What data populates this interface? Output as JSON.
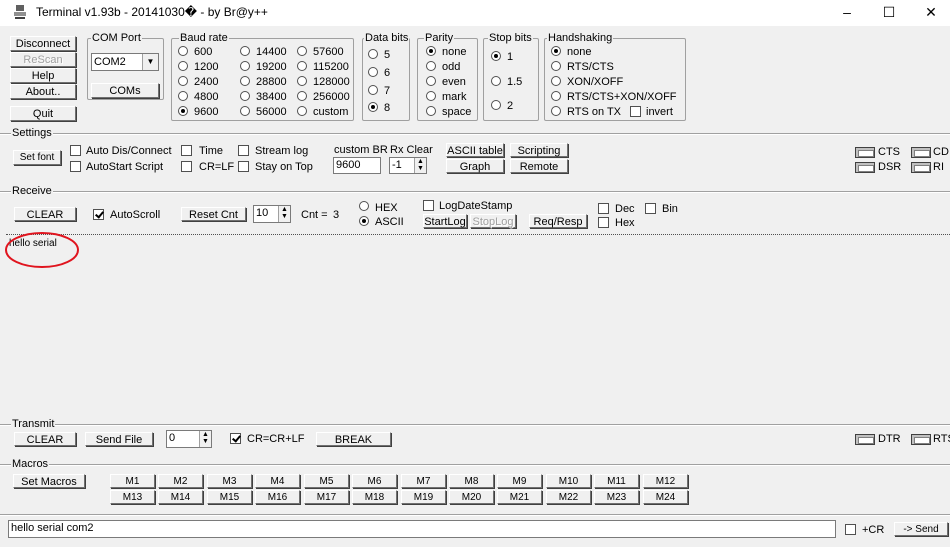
{
  "window": {
    "title": "Terminal v1.93b - 20141030� - by Br@y++",
    "icon_name": "terminal-app-icon",
    "minimize_glyph": "–",
    "maximize_glyph": "☐",
    "close_glyph": "✕"
  },
  "top_buttons": {
    "disconnect": "Disconnect",
    "rescan": "ReScan",
    "help": "Help",
    "about": "About..",
    "quit": "Quit"
  },
  "com_port": {
    "label": "COM Port",
    "selected": "COM2",
    "coms_button": "COMs"
  },
  "baud_rate": {
    "label": "Baud rate",
    "options": [
      "600",
      "1200",
      "2400",
      "4800",
      "9600",
      "14400",
      "19200",
      "28800",
      "38400",
      "56000",
      "57600",
      "115200",
      "128000",
      "256000",
      "custom"
    ],
    "selected": "9600"
  },
  "data_bits": {
    "label": "Data bits",
    "options": [
      "5",
      "6",
      "7",
      "8"
    ],
    "selected": "8"
  },
  "parity": {
    "label": "Parity",
    "options": [
      "none",
      "odd",
      "even",
      "mark",
      "space"
    ],
    "selected": "none"
  },
  "stop_bits": {
    "label": "Stop bits",
    "options": [
      "1",
      "1.5",
      "2"
    ],
    "selected": "1"
  },
  "handshaking": {
    "label": "Handshaking",
    "options": [
      "none",
      "RTS/CTS",
      "XON/XOFF",
      "RTS/CTS+XON/XOFF",
      "RTS on TX"
    ],
    "selected": "none",
    "invert_label": "invert"
  },
  "settings": {
    "label": "Settings",
    "set_font": "Set font",
    "auto_dis_connect": "Auto Dis/Connect",
    "autostart_script": "AutoStart Script",
    "time": "Time",
    "cr_lf": "CR=LF",
    "stream_log": "Stream log",
    "stay_on_top": "Stay on Top",
    "custom_br_label": "custom BR",
    "custom_br_value": "9600",
    "rx_clear_label": "Rx Clear",
    "rx_clear_value": "-1",
    "ascii_table": "ASCII table",
    "graph": "Graph",
    "scripting": "Scripting",
    "remote": "Remote",
    "leds": [
      "CTS",
      "CD",
      "DSR",
      "RI"
    ]
  },
  "receive": {
    "label": "Receive",
    "clear": "CLEAR",
    "autoscroll": "AutoScroll",
    "reset_cnt": "Reset Cnt",
    "cnt_spin_value": "10",
    "cnt_label": "Cnt =",
    "cnt_value": "3",
    "hex": "HEX",
    "ascii": "ASCII",
    "mode_selected": "ASCII",
    "log_date_stamp": "LogDateStamp",
    "start_log": "StartLog",
    "stop_log": "StopLog",
    "req_resp": "Req/Resp",
    "dec": "Dec",
    "hex_chk": "Hex",
    "bin": "Bin",
    "text": "hello serial"
  },
  "transmit": {
    "label": "Transmit",
    "clear": "CLEAR",
    "send_file": "Send File",
    "spin_value": "0",
    "cr_crlf": "CR=CR+LF",
    "break": "BREAK",
    "leds": [
      "DTR",
      "RTS"
    ]
  },
  "macros": {
    "label": "Macros",
    "set_macros": "Set Macros",
    "row1": [
      "M1",
      "M2",
      "M3",
      "M4",
      "M5",
      "M6",
      "M7",
      "M8",
      "M9",
      "M10",
      "M11",
      "M12"
    ],
    "row2": [
      "M13",
      "M14",
      "M15",
      "M16",
      "M17",
      "M18",
      "M19",
      "M20",
      "M21",
      "M22",
      "M23",
      "M24"
    ]
  },
  "send_bar": {
    "input_value": "hello serial com2",
    "plus_cr": "+CR",
    "send": "-> Send"
  },
  "colors": {
    "annotation_circle": "#e0141e",
    "face": "#f0f0f0"
  }
}
